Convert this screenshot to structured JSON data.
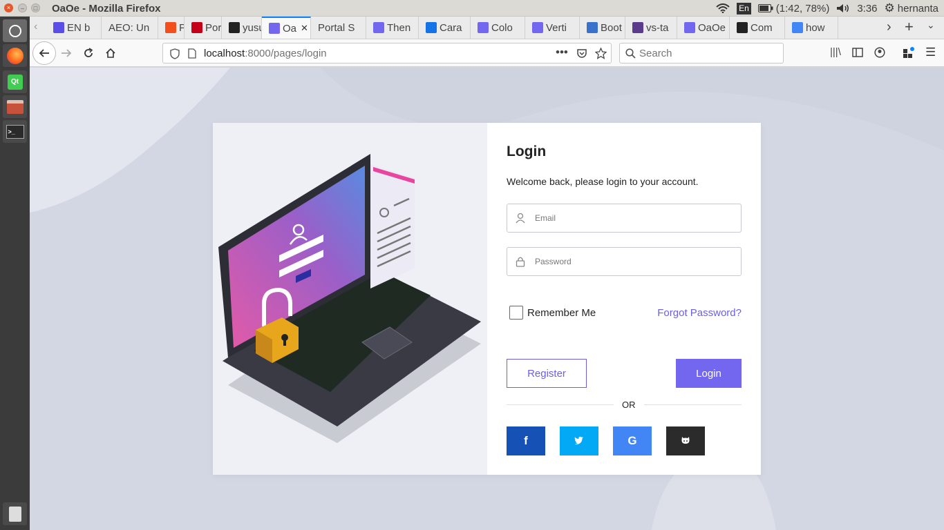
{
  "window": {
    "title": "OaOe - Mozilla Firefox"
  },
  "tray": {
    "lang": "En",
    "battery": "(1:42, 78%)",
    "time": "3:36",
    "user": "hernanta"
  },
  "tabs": [
    {
      "label": "EN b",
      "fav_color": "#5b4ee8"
    },
    {
      "label": "AEO: Un",
      "fav_color": ""
    },
    {
      "label": "Porta",
      "fav_color": "#f24e1e"
    },
    {
      "label": "Porta",
      "fav_color": "#c4001b"
    },
    {
      "label": "yusu",
      "fav_color": "#222222"
    },
    {
      "label": "Oa",
      "fav_color": "#7367f0"
    },
    {
      "label": "Portal S",
      "fav_color": ""
    },
    {
      "label": "Then",
      "fav_color": "#7367f0"
    },
    {
      "label": "Cara",
      "fav_color": "#1473e6"
    },
    {
      "label": "Colo",
      "fav_color": "#7367f0"
    },
    {
      "label": "Verti",
      "fav_color": "#7367f0"
    },
    {
      "label": "Boot",
      "fav_color": "#3b71ca"
    },
    {
      "label": "vs-ta",
      "fav_color": "#5b3b8c"
    },
    {
      "label": "OaOe",
      "fav_color": "#7367f0"
    },
    {
      "label": "Com",
      "fav_color": "#222222"
    },
    {
      "label": "how",
      "fav_color": "#4285f4"
    }
  ],
  "url": {
    "host": "localhost",
    "rest": ":8000/pages/login"
  },
  "search": {
    "placeholder": "Search"
  },
  "login": {
    "title": "Login",
    "subtitle": "Welcome back, please login to your account.",
    "email_placeholder": "Email",
    "password_placeholder": "Password",
    "remember_label": "Remember Me",
    "forgot_label": "Forgot Password?",
    "register_label": "Register",
    "login_label": "Login",
    "or_label": "OR",
    "social": [
      {
        "name": "facebook",
        "glyph": "f",
        "color": "#1651b5"
      },
      {
        "name": "twitter",
        "glyph": "t",
        "color": "#03a9f4"
      },
      {
        "name": "google",
        "glyph": "G",
        "color": "#4285f4"
      },
      {
        "name": "github",
        "glyph": "gh",
        "color": "#2b2b2b"
      }
    ]
  },
  "colors": {
    "accent": "#7367f0",
    "page_bg": "#d3d7e3"
  }
}
